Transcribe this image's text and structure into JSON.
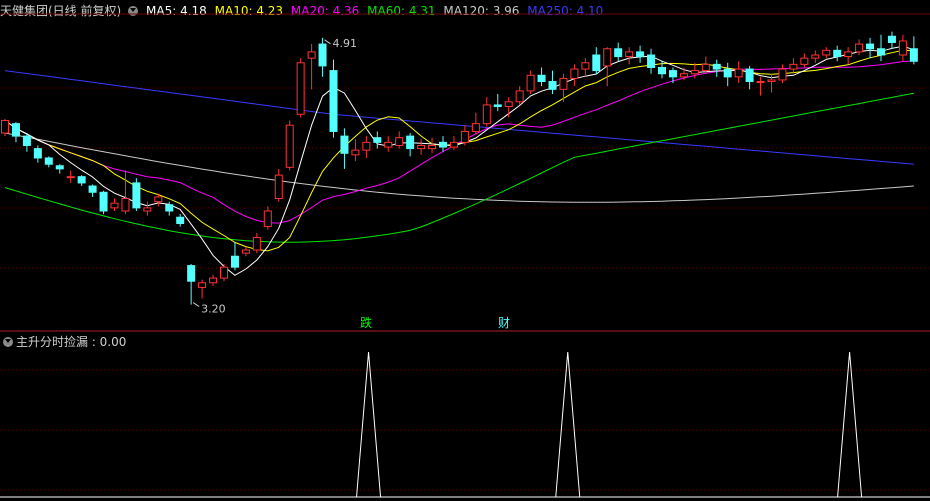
{
  "header": {
    "title": "天健集团(日线 前复权)",
    "ma": [
      {
        "label": "MA5: 4.18",
        "color": "#ffffff"
      },
      {
        "label": "MA10: 4.23",
        "color": "#ffff00"
      },
      {
        "label": "MA20: 4.36",
        "color": "#ff00ff"
      },
      {
        "label": "MA60: 4.31",
        "color": "#00e600"
      },
      {
        "label": "MA120: 3.96",
        "color": "#c8c8c8"
      },
      {
        "label": "MA250: 4.10",
        "color": "#3a3aff"
      }
    ]
  },
  "indicator": {
    "label": "主升分时捡漏 : 0.00"
  },
  "markers": {
    "die": "跌",
    "cai": "财"
  },
  "chart_data": {
    "type": "candlestick",
    "title": "天健集团(日线 前复权)",
    "price_range": [
      3.05,
      5.05
    ],
    "annotations": [
      {
        "text": "4.91",
        "price": 4.91,
        "index": 29
      },
      {
        "text": "3.20",
        "price": 3.2,
        "index": 17
      }
    ],
    "colors": {
      "up": "#ff3232",
      "down": "#54ffff",
      "bg": "#000000"
    },
    "candles": [
      [
        4.3,
        4.38,
        4.39,
        4.28
      ],
      [
        4.36,
        4.28,
        4.37,
        4.24
      ],
      [
        4.28,
        4.22,
        4.3,
        4.18
      ],
      [
        4.2,
        4.14,
        4.22,
        4.11
      ],
      [
        4.14,
        4.1,
        4.15,
        4.08
      ],
      [
        4.09,
        4.07,
        4.1,
        4.04
      ],
      [
        4.02,
        4.02,
        4.06,
        3.98
      ],
      [
        4.02,
        3.98,
        4.03,
        3.96
      ],
      [
        3.96,
        3.92,
        3.97,
        3.89
      ],
      [
        3.92,
        3.8,
        3.93,
        3.78
      ],
      [
        3.82,
        3.85,
        3.88,
        3.8
      ],
      [
        3.8,
        3.88,
        4.06,
        3.78
      ],
      [
        3.98,
        3.82,
        4.01,
        3.8
      ],
      [
        3.8,
        3.82,
        3.86,
        3.77
      ],
      [
        3.86,
        3.89,
        3.91,
        3.83
      ],
      [
        3.84,
        3.8,
        3.86,
        3.77
      ],
      [
        3.76,
        3.72,
        3.78,
        3.7
      ],
      [
        3.45,
        3.35,
        3.46,
        3.2
      ],
      [
        3.31,
        3.34,
        3.36,
        3.24
      ],
      [
        3.34,
        3.37,
        3.39,
        3.32
      ],
      [
        3.37,
        3.44,
        3.46,
        3.35
      ],
      [
        3.51,
        3.44,
        3.6,
        3.42
      ],
      [
        3.53,
        3.55,
        3.57,
        3.51
      ],
      [
        3.55,
        3.63,
        3.66,
        3.53
      ],
      [
        3.7,
        3.8,
        3.83,
        3.68
      ],
      [
        3.88,
        4.03,
        4.07,
        3.86
      ],
      [
        4.08,
        4.35,
        4.38,
        4.06
      ],
      [
        4.42,
        4.75,
        4.78,
        4.4
      ],
      [
        4.78,
        4.82,
        4.87,
        4.58
      ],
      [
        4.87,
        4.73,
        4.91,
        4.66
      ],
      [
        4.7,
        4.31,
        4.77,
        4.27
      ],
      [
        4.28,
        4.17,
        4.33,
        4.07
      ],
      [
        4.16,
        4.19,
        4.26,
        4.12
      ],
      [
        4.19,
        4.24,
        4.28,
        4.14
      ],
      [
        4.27,
        4.24,
        4.31,
        4.2
      ],
      [
        4.21,
        4.24,
        4.28,
        4.18
      ],
      [
        4.22,
        4.27,
        4.31,
        4.2
      ],
      [
        4.28,
        4.2,
        4.3,
        4.15
      ],
      [
        4.2,
        4.22,
        4.26,
        4.16
      ],
      [
        4.2,
        4.22,
        4.27,
        4.17
      ],
      [
        4.24,
        4.21,
        4.28,
        4.18
      ],
      [
        4.21,
        4.24,
        4.28,
        4.19
      ],
      [
        4.24,
        4.31,
        4.35,
        4.22
      ],
      [
        4.31,
        4.36,
        4.43,
        4.29
      ],
      [
        4.36,
        4.48,
        4.53,
        4.34
      ],
      [
        4.48,
        4.47,
        4.55,
        4.44
      ],
      [
        4.47,
        4.5,
        4.53,
        4.4
      ],
      [
        4.5,
        4.57,
        4.6,
        4.48
      ],
      [
        4.57,
        4.67,
        4.7,
        4.55
      ],
      [
        4.67,
        4.63,
        4.72,
        4.6
      ],
      [
        4.63,
        4.58,
        4.7,
        4.55
      ],
      [
        4.58,
        4.65,
        4.68,
        4.5
      ],
      [
        4.65,
        4.71,
        4.74,
        4.6
      ],
      [
        4.71,
        4.75,
        4.78,
        4.66
      ],
      [
        4.8,
        4.7,
        4.85,
        4.68
      ],
      [
        4.73,
        4.84,
        4.85,
        4.6
      ],
      [
        4.84,
        4.79,
        4.88,
        4.76
      ],
      [
        4.79,
        4.82,
        4.85,
        4.74
      ],
      [
        4.82,
        4.79,
        4.86,
        4.75
      ],
      [
        4.8,
        4.72,
        4.84,
        4.68
      ],
      [
        4.72,
        4.68,
        4.76,
        4.65
      ],
      [
        4.7,
        4.66,
        4.72,
        4.62
      ],
      [
        4.66,
        4.68,
        4.72,
        4.64
      ],
      [
        4.68,
        4.7,
        4.75,
        4.65
      ],
      [
        4.7,
        4.74,
        4.79,
        4.68
      ],
      [
        4.74,
        4.71,
        4.77,
        4.66
      ],
      [
        4.71,
        4.66,
        4.75,
        4.6
      ],
      [
        4.66,
        4.71,
        4.76,
        4.62
      ],
      [
        4.71,
        4.63,
        4.73,
        4.58
      ],
      [
        4.63,
        4.63,
        4.66,
        4.54
      ],
      [
        4.63,
        4.64,
        4.68,
        4.56
      ],
      [
        4.64,
        4.71,
        4.74,
        4.62
      ],
      [
        4.71,
        4.74,
        4.78,
        4.68
      ],
      [
        4.74,
        4.78,
        4.81,
        4.72
      ],
      [
        4.78,
        4.8,
        4.83,
        4.75
      ],
      [
        4.8,
        4.83,
        4.85,
        4.78
      ],
      [
        4.83,
        4.79,
        4.86,
        4.76
      ],
      [
        4.79,
        4.82,
        4.85,
        4.74
      ],
      [
        4.82,
        4.87,
        4.9,
        4.8
      ],
      [
        4.87,
        4.84,
        4.91,
        4.78
      ],
      [
        4.84,
        4.8,
        4.93,
        4.76
      ],
      [
        4.92,
        4.88,
        4.95,
        4.84
      ],
      [
        4.8,
        4.89,
        4.93,
        4.76
      ],
      [
        4.84,
        4.76,
        4.92,
        4.74
      ]
    ],
    "indicator_signals": [
      29,
      45,
      68
    ]
  }
}
